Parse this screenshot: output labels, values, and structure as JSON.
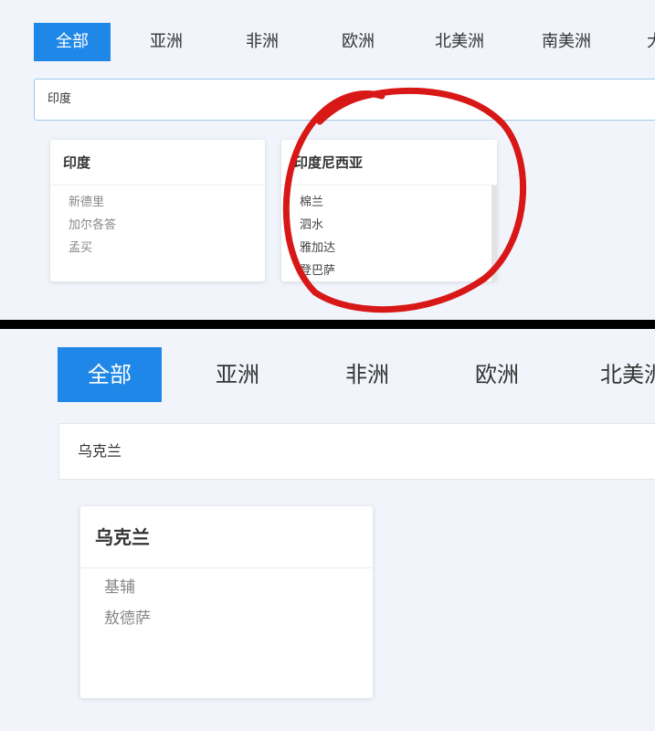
{
  "top": {
    "tabs": [
      {
        "label": "全部",
        "active": true
      },
      {
        "label": "亚洲"
      },
      {
        "label": "非洲"
      },
      {
        "label": "欧洲"
      },
      {
        "label": "北美洲"
      },
      {
        "label": "南美洲"
      },
      {
        "label": "大"
      }
    ],
    "search_value": "印度",
    "cards": [
      {
        "title": "印度",
        "cities": [
          "新德里",
          "加尔各答",
          "孟买"
        ]
      },
      {
        "title": "印度尼西亚",
        "cities": [
          "棉兰",
          "泗水",
          "雅加达",
          "登巴萨"
        ]
      }
    ],
    "annotation_color": "#d81717"
  },
  "bottom": {
    "tabs": [
      {
        "label": "全部",
        "active": true
      },
      {
        "label": "亚洲"
      },
      {
        "label": "非洲"
      },
      {
        "label": "欧洲"
      },
      {
        "label": "北美洲"
      }
    ],
    "search_value": "乌克兰",
    "cards": [
      {
        "title": "乌克兰",
        "cities": [
          "基辅",
          "敖德萨"
        ]
      }
    ]
  },
  "colors": {
    "accent": "#1f87e8",
    "background": "#f1f5fb",
    "divider": "#000000"
  }
}
